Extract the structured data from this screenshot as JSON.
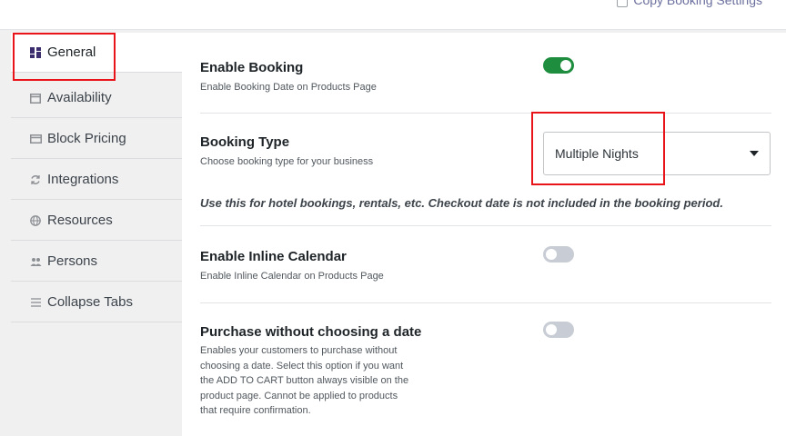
{
  "header": {
    "copy_label": "Copy Booking Settings"
  },
  "sidebar": {
    "tabs": [
      {
        "label": "General",
        "icon": "dashboard-icon",
        "active": true
      },
      {
        "label": "Availability",
        "icon": "calendar-icon"
      },
      {
        "label": "Block Pricing",
        "icon": "card-icon"
      },
      {
        "label": "Integrations",
        "icon": "sync-icon"
      },
      {
        "label": "Resources",
        "icon": "globe-icon"
      },
      {
        "label": "Persons",
        "icon": "people-icon"
      },
      {
        "label": "Collapse Tabs",
        "icon": "menu-icon"
      }
    ]
  },
  "settings": {
    "enable_booking": {
      "title": "Enable Booking",
      "desc": "Enable Booking Date on Products Page",
      "enabled": true
    },
    "booking_type": {
      "title": "Booking Type",
      "desc": "Choose booking type for your business",
      "value": "Multiple Nights"
    },
    "booking_note": "Use this for hotel bookings, rentals, etc. Checkout date is not included in the booking period.",
    "inline_calendar": {
      "title": "Enable Inline Calendar",
      "desc": "Enable Inline Calendar on Products Page",
      "enabled": false
    },
    "purchase_without_date": {
      "title": "Purchase without choosing a date",
      "desc_lines": [
        "Enables your customers to purchase without",
        "choosing a date. Select this option if you want",
        "the ADD TO CART button always visible on the",
        "product page. Cannot be applied to products",
        "that require confirmation."
      ],
      "enabled": false
    }
  },
  "colors": {
    "toggle_on": "#1e8e3e",
    "toggle_off": "#c8ccd4",
    "highlight": "#e8141a",
    "active_icon": "#3b2d6e"
  }
}
